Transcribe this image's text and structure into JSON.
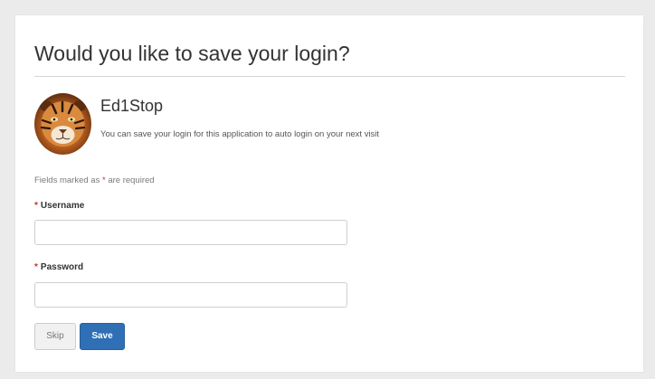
{
  "dialog": {
    "title": "Would you like to save your login?"
  },
  "app": {
    "name": "Ed1Stop",
    "description": "You can save your login for this application to auto login on your next visit"
  },
  "form": {
    "required_note_prefix": "Fields marked as ",
    "required_star": "*",
    "required_note_suffix": " are required",
    "username": {
      "label": "Username",
      "value": "",
      "placeholder": ""
    },
    "password": {
      "label": "Password",
      "value": "",
      "placeholder": ""
    }
  },
  "buttons": {
    "skip_label": "Skip",
    "save_label": "Save"
  },
  "colors": {
    "page_background": "#ebebeb",
    "card_background": "#ffffff",
    "required_star": "#c9302c",
    "primary_button": "#2f6fb5"
  },
  "icons": {
    "avatar": "tiger-avatar-icon"
  }
}
